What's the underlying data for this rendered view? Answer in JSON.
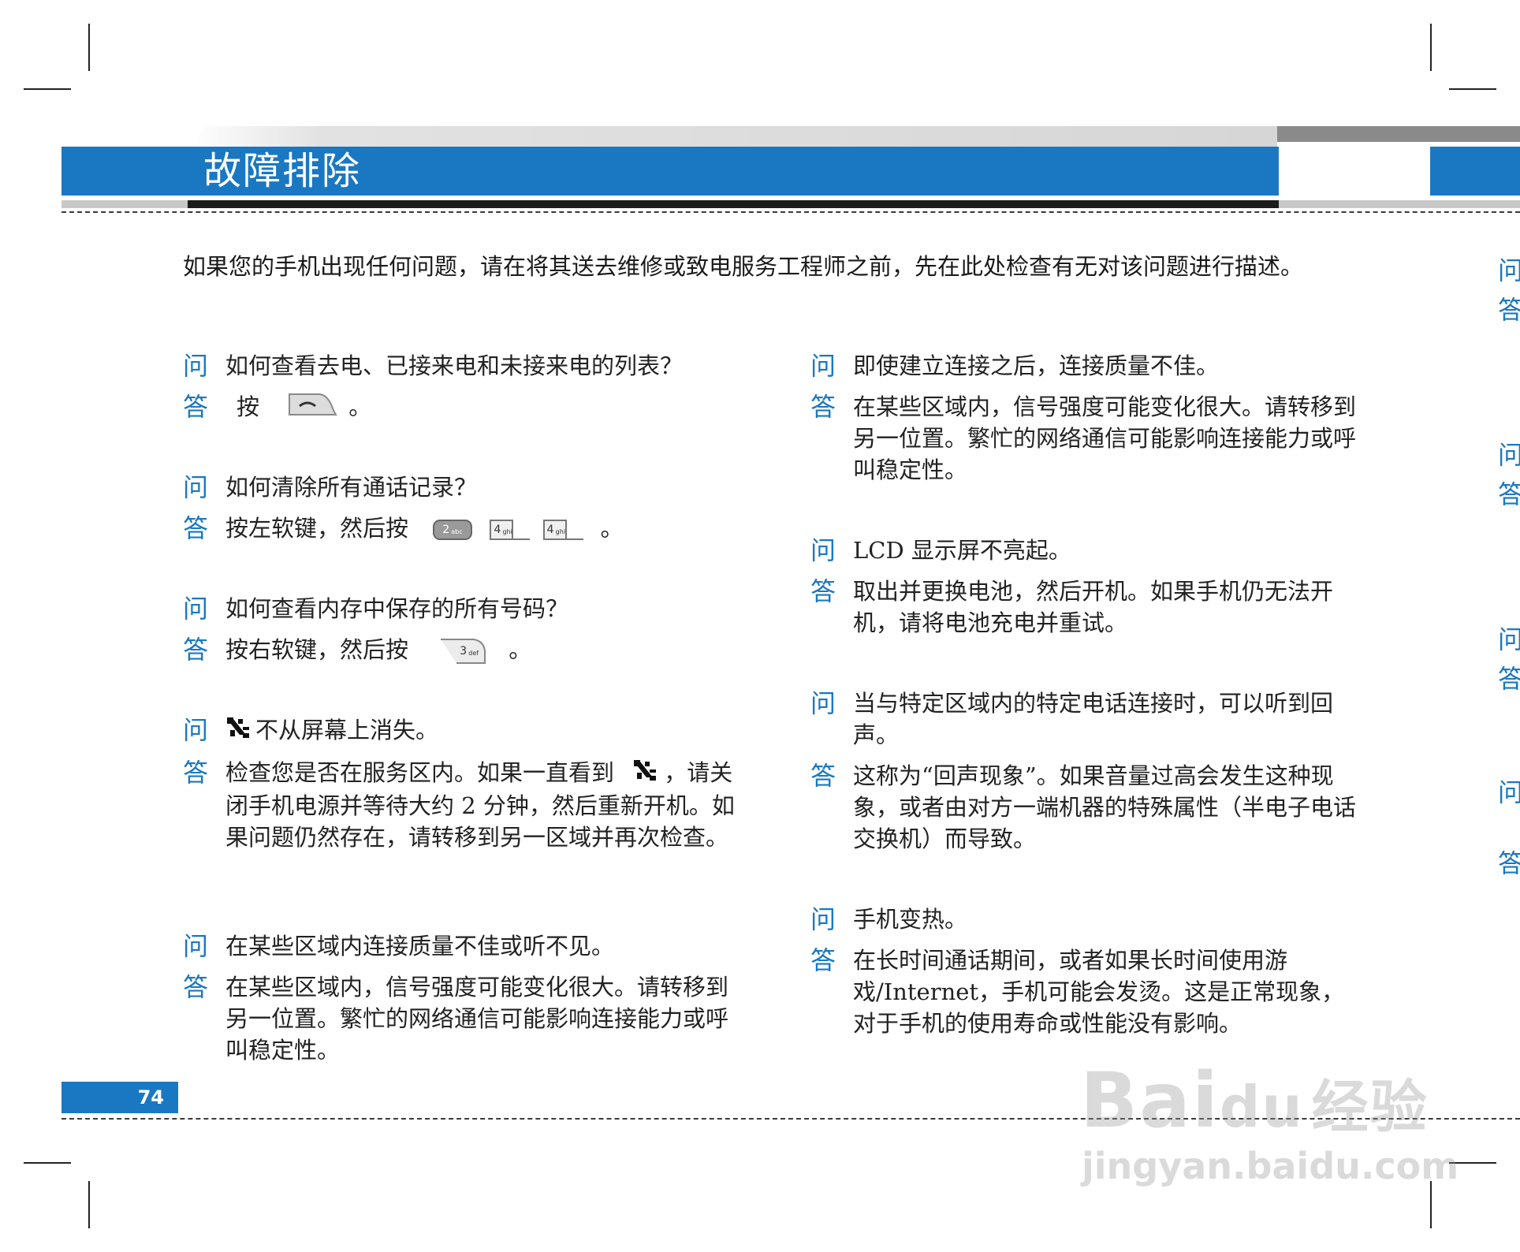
{
  "header": {
    "title": "故障排除"
  },
  "intro": "如果您的手机出现任何问题，请在将其送去维修或致电服务工程师之前，先在此处检查有无对该问题进行描述。",
  "labels": {
    "q": "问",
    "a": "答"
  },
  "left_column": [
    {
      "q": "如何查看去电、已接来电和未接来电的列表？",
      "a_prefix": "按",
      "a_suffix": "。"
    },
    {
      "q": "如何清除所有通话记录？",
      "a_prefix": "按左软键，然后按",
      "a_suffix": "。"
    },
    {
      "q": "如何查看内存中保存的所有号码？",
      "a_prefix": "按右软键，然后按",
      "a_suffix": "。"
    },
    {
      "q": "不从屏幕上消失。",
      "a_prefix": "检查您是否在服务区内。如果一直看到",
      "a_suffix": "，请关闭手机电源并等待大约 2 分钟，然后重新开机。如果问题仍然存在，请转移到另一区域并再次检查。"
    },
    {
      "q": "在某些区域内连接质量不佳或听不见。",
      "a": "在某些区域内，信号强度可能变化很大。请转移到另一位置。繁忙的网络通信可能影响连接能力或呼叫稳定性。"
    }
  ],
  "right_column": [
    {
      "q": "即使建立连接之后，连接质量不佳。",
      "a": "在某些区域内，信号强度可能变化很大。请转移到另一位置。繁忙的网络通信可能影响连接能力或呼叫稳定性。"
    },
    {
      "q": "LCD 显示屏不亮起。",
      "a": "取出并更换电池，然后开机。如果手机仍无法开机，请将电池充电并重试。"
    },
    {
      "q": "当与特定区域内的特定电话连接时，可以听到回声。",
      "a": "这称为“回声现象”。如果音量过高会发生这种现象，或者由对方一端机器的特殊属性（半电子电话交换机）而导致。"
    },
    {
      "q": "手机变热。",
      "a": "在长时间通话期间，或者如果长时间使用游戏/Internet，手机可能会发烫。这是正常现象，对于手机的使用寿命或性能没有影响。"
    }
  ],
  "keys": {
    "key2": "2",
    "key2_sub": "abc",
    "key4": "4",
    "key4_sub": "ghi",
    "key3": "3",
    "key3_sub": "def"
  },
  "edge_marks": [
    "问",
    "答",
    "问",
    "答",
    "问",
    "答",
    "问",
    "答"
  ],
  "page_number": "74",
  "watermark": {
    "brand": "Bai",
    "brand2": "du",
    "product": "经验",
    "url": "jingyan.baidu.com"
  }
}
